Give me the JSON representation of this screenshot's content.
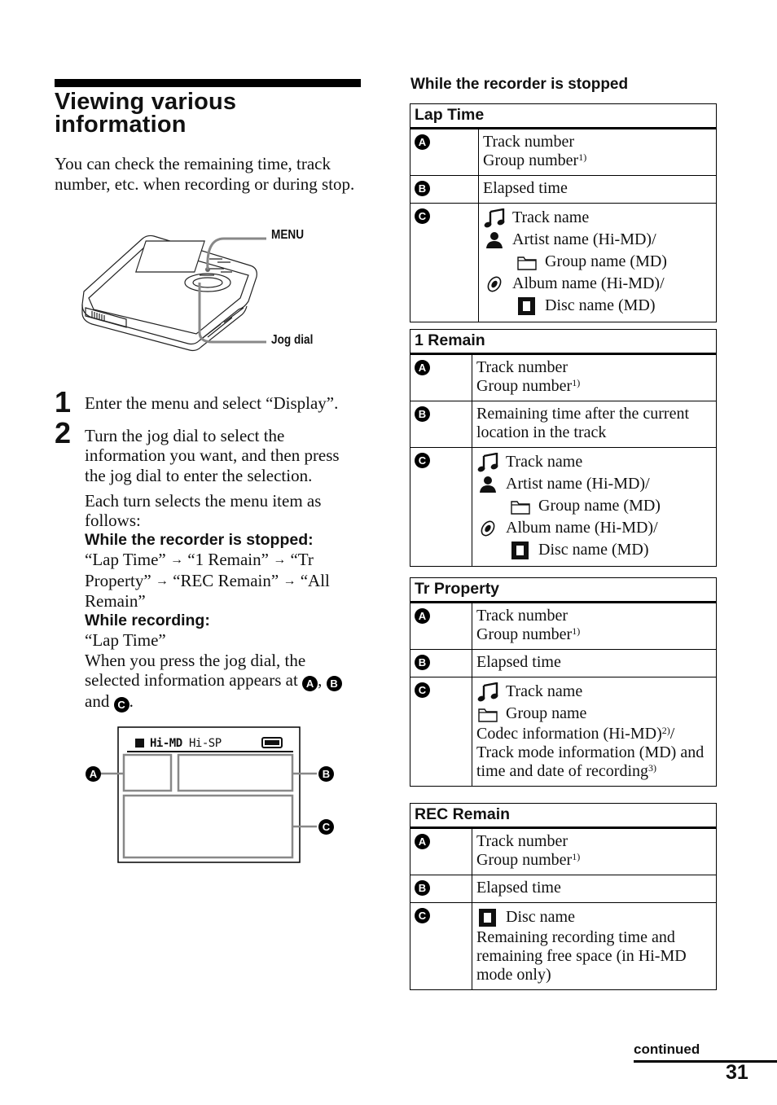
{
  "left": {
    "title_line1": "Viewing various",
    "title_line2": "information",
    "intro": "You can check the remaining time, track number, etc. when recording or during stop.",
    "figure_labels": {
      "menu": "MENU",
      "jog_dial": "Jog dial"
    },
    "steps": [
      {
        "number": "1",
        "text": "Enter the menu and select “Display”."
      },
      {
        "number": "2",
        "text": "Turn the jog dial to select the information you want, and then press the jog dial to enter the selection.",
        "sub_text": "Each turn selects the menu item as follows:",
        "stopped_heading": "While the recorder is stopped:",
        "stopped_sequence": [
          "“Lap Time”",
          "“1 Remain”",
          "“Tr Property”",
          "“REC Remain”",
          "“All Remain”"
        ],
        "recording_heading": "While recording:",
        "recording_sequence": "“Lap Time”",
        "press_text_1": "When you press the jog dial, the selected information appears at",
        "press_and": "and",
        "press_end": "."
      }
    ],
    "display": {
      "status_text": "Hi-MD",
      "mode_text": "Hi-SP",
      "markers": [
        "A",
        "B",
        "C"
      ]
    },
    "arrow_glyph": "→"
  },
  "right": {
    "heading": "While the recorder is stopped",
    "tables": [
      {
        "title": "Lap Time",
        "rows": [
          {
            "label": "A",
            "lines": [
              {
                "text": "Track number"
              },
              {
                "text": "Group number",
                "sup": "1)"
              }
            ]
          },
          {
            "label": "B",
            "lines": [
              {
                "text": "Elapsed time"
              }
            ]
          },
          {
            "label": "C",
            "icon_lines": [
              {
                "icon": "music-note-icon",
                "text": "Track name"
              },
              {
                "icon": "person-icon",
                "text": "Artist name (Hi-MD)/"
              },
              {
                "icon": "folder-icon",
                "text": "Group name (MD)",
                "indent": true
              },
              {
                "icon": "album-disc-icon",
                "text": "Album name (Hi-MD)/"
              },
              {
                "icon": "md-disc-icon",
                "text": "Disc name (MD)",
                "indent": true
              }
            ]
          }
        ]
      },
      {
        "title": "1 Remain",
        "rows": [
          {
            "label": "A",
            "lines": [
              {
                "text": "Track number"
              },
              {
                "text": "Group number",
                "sup": "1)"
              }
            ]
          },
          {
            "label": "B",
            "lines": [
              {
                "text": "Remaining time after the current"
              },
              {
                "text": "location in the track"
              }
            ]
          },
          {
            "label": "C",
            "icon_lines": [
              {
                "icon": "music-note-icon",
                "text": "Track name"
              },
              {
                "icon": "person-icon",
                "text": "Artist name (Hi-MD)/"
              },
              {
                "icon": "folder-icon",
                "text": "Group name (MD)",
                "indent": true
              },
              {
                "icon": "album-disc-icon",
                "text": "Album name (Hi-MD)/"
              },
              {
                "icon": "md-disc-icon",
                "text": "Disc name (MD)",
                "indent": true
              }
            ]
          }
        ]
      },
      {
        "title": "Tr Property",
        "rows": [
          {
            "label": "A",
            "lines": [
              {
                "text": "Track number"
              },
              {
                "text": "Group number",
                "sup": "1)"
              }
            ]
          },
          {
            "label": "B",
            "lines": [
              {
                "text": "Elapsed time"
              }
            ]
          },
          {
            "label": "C",
            "icon_lines": [
              {
                "icon": "music-note-icon",
                "text": "Track name"
              },
              {
                "icon": "folder-icon",
                "text": "Group name"
              }
            ],
            "lines": [
              {
                "text": "Codec information (Hi-MD)",
                "sup": "2)",
                "suffix": "/"
              },
              {
                "text": "Track mode information (MD) and"
              },
              {
                "text": "time and date of recording",
                "sup": "3)"
              }
            ]
          }
        ]
      },
      {
        "title": "REC Remain",
        "rows": [
          {
            "label": "A",
            "lines": [
              {
                "text": "Track number"
              },
              {
                "text": "Group number",
                "sup": "1)"
              }
            ]
          },
          {
            "label": "B",
            "lines": [
              {
                "text": "Elapsed time"
              }
            ]
          },
          {
            "label": "C",
            "icon_lines": [
              {
                "icon": "md-disc-icon",
                "text": "Disc name"
              }
            ],
            "lines": [
              {
                "text": "Remaining recording time and"
              },
              {
                "text": "remaining free space (in Hi-MD"
              },
              {
                "text": "mode only)"
              }
            ]
          }
        ]
      }
    ]
  },
  "footer": {
    "continued": "continued",
    "page_number": "31"
  }
}
